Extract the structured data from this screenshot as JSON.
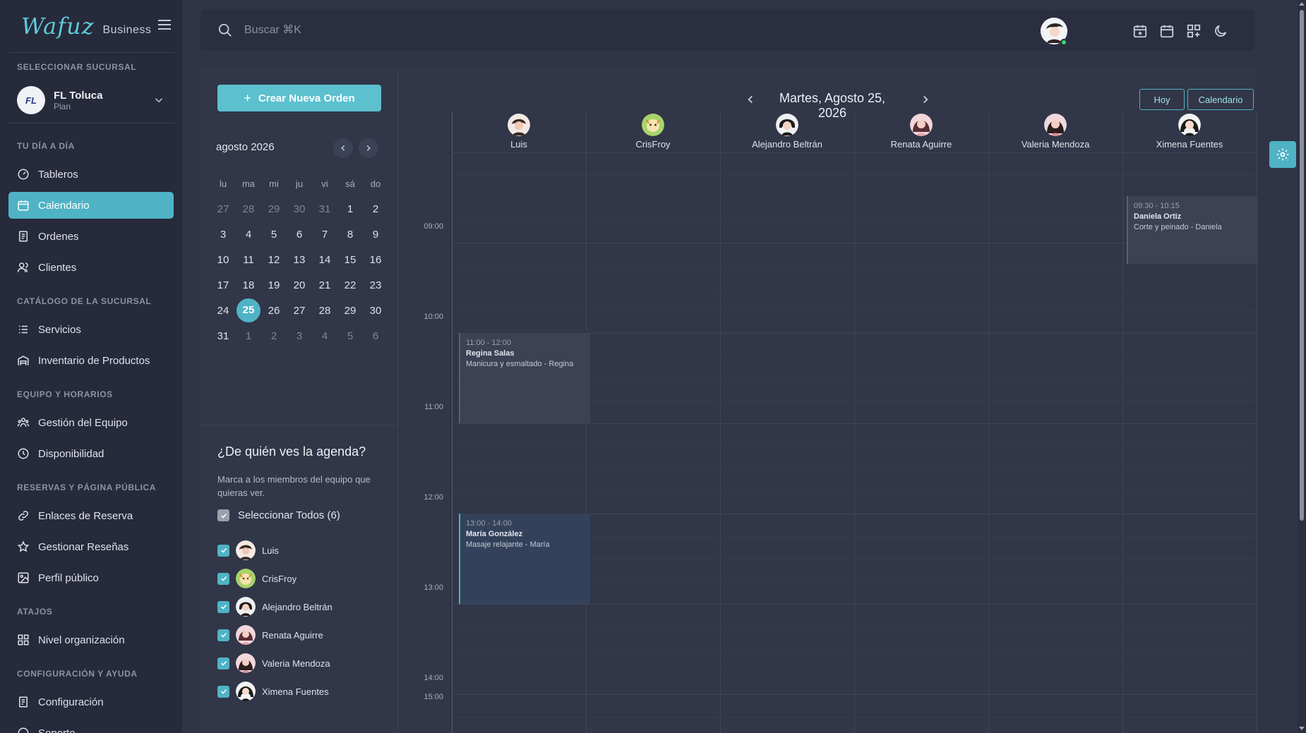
{
  "brand": {
    "logo": "Wafuz",
    "sub": "Business"
  },
  "sidebar": {
    "branch_section": "SELECCIONAR SUCURSAL",
    "branch": {
      "initials": "FL",
      "name": "FL Toluca",
      "plan": "Plan"
    },
    "sections": {
      "day": "TU DÍA A DÍA",
      "catalog": "CATÁLOGO DE LA SUCURSAL",
      "team": "EQUIPO Y HORARIOS",
      "bookings": "RESERVAS Y PÁGINA PÚBLICA",
      "shortcuts": "ATAJOS",
      "config": "CONFIGURACIÓN Y AYUDA"
    },
    "items": {
      "dashboards": "Tableros",
      "calendar": "Calendario",
      "orders": "Ordenes",
      "clients": "Clientes",
      "services": "Servicios",
      "inventory": "Inventario de Productos",
      "team": "Gestión del Equipo",
      "availability": "Disponibilidad",
      "booking_links": "Enlaces de Reserva",
      "reviews": "Gestionar Reseñas",
      "public_profile": "Perfil público",
      "org_level": "Nivel organización",
      "settings": "Configuración",
      "support": "Soporte"
    }
  },
  "topbar": {
    "search_placeholder": "Buscar ⌘K"
  },
  "leftcol": {
    "create_button": "Crear Nueva Orden",
    "month_title": "agosto 2026",
    "weekdays": [
      "lu",
      "ma",
      "mi",
      "ju",
      "vi",
      "sá",
      "do"
    ],
    "weeks": [
      [
        "27",
        "28",
        "29",
        "30",
        "31",
        "1",
        "2"
      ],
      [
        "3",
        "4",
        "5",
        "6",
        "7",
        "8",
        "9"
      ],
      [
        "10",
        "11",
        "12",
        "13",
        "14",
        "15",
        "16"
      ],
      [
        "17",
        "18",
        "19",
        "20",
        "21",
        "22",
        "23"
      ],
      [
        "24",
        "25",
        "26",
        "27",
        "28",
        "29",
        "30"
      ],
      [
        "31",
        "1",
        "2",
        "3",
        "4",
        "5",
        "6"
      ]
    ],
    "agenda_title": "¿De quién ves la agenda?",
    "agenda_desc": "Marca a los miembros del equipo que quieras ver.",
    "select_all": "Seleccionar Todos (6)",
    "members": [
      "Luis",
      "CrisFroy",
      "Alejandro Beltrán",
      "Renata Aguirre",
      "Valeria Mendoza",
      "Ximena Fuentes"
    ]
  },
  "day": {
    "title": "Martes, Agosto 25, 2026",
    "today_button": "Hoy",
    "calendar_button": "Calendario",
    "staff": [
      "Luis",
      "CrisFroy",
      "Alejandro Beltrán",
      "Renata Aguirre",
      "Valeria Mendoza",
      "Ximena Fuentes"
    ],
    "hours": [
      "09:00",
      "10:00",
      "11:00",
      "12:00",
      "13:00",
      "14:00",
      "15:00"
    ],
    "events": [
      {
        "time": "09:30 - 10:15",
        "client": "Daniela Ortiz",
        "service": "Corte y peinado - Daniela"
      },
      {
        "time": "11:00 - 12:00",
        "client": "Regina Salas",
        "service": "Manicura y esmaltado - Regina"
      },
      {
        "time": "13:00 - 14:00",
        "client": "María González",
        "service": "Masaje relajante - María"
      }
    ]
  },
  "colors": {
    "accent": "#4fb3c5",
    "sidebar": "#262a3b",
    "panel": "#313648"
  }
}
